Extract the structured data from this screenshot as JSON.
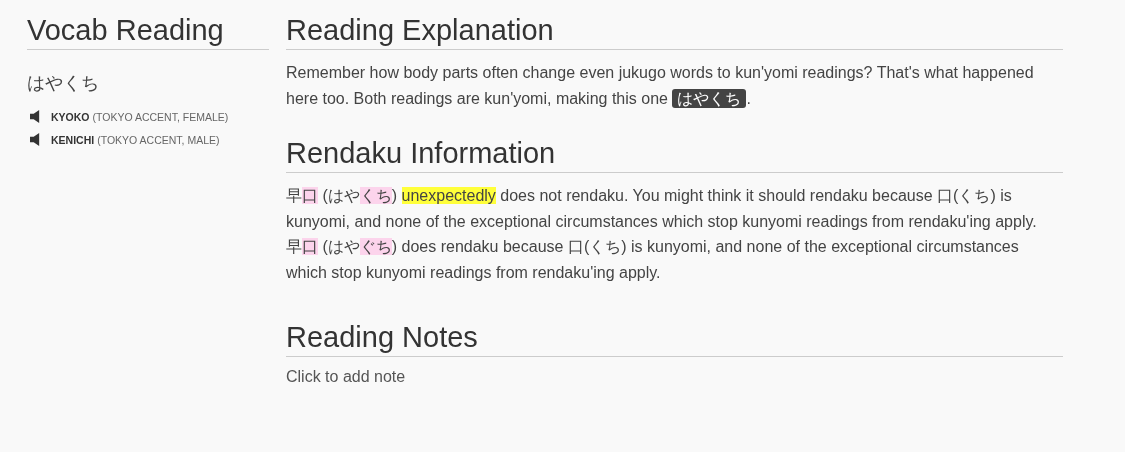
{
  "sidebar": {
    "title": "Vocab Reading",
    "reading": "はやくち",
    "audio": [
      {
        "name": "KYOKO",
        "detail": "(TOKYO ACCENT, FEMALE)"
      },
      {
        "name": "KENICHI",
        "detail": "(TOKYO ACCENT, MALE)"
      }
    ]
  },
  "sections": [
    {
      "title": "Reading Explanation",
      "paragraphs": [
        [
          {
            "text": "Remember how body parts often change even jukugo words to kun'yomi readings? That's what happened here too. Both readings are kun'yomi, making this one ",
            "kind": "plain"
          },
          {
            "text": "はやくち",
            "kind": "chip"
          },
          {
            "text": ".",
            "kind": "plain"
          }
        ]
      ]
    },
    {
      "title": "Rendaku Information",
      "paragraphs": [
        [
          {
            "text": "早",
            "kind": "plain"
          },
          {
            "text": "口",
            "kind": "pink"
          },
          {
            "text": " (はや",
            "kind": "plain"
          },
          {
            "text": "くち",
            "kind": "pink"
          },
          {
            "text": ") ",
            "kind": "plain"
          },
          {
            "text": "unexpectedly",
            "kind": "yellow"
          },
          {
            "text": " does not rendaku. You might think it should rendaku because 口(くち) is kunyomi, and none of the exceptional circumstances which stop kunyomi readings from rendaku'ing apply.",
            "kind": "plain"
          }
        ],
        [
          {
            "text": "早",
            "kind": "plain"
          },
          {
            "text": "口",
            "kind": "pink"
          },
          {
            "text": " (はや",
            "kind": "plain"
          },
          {
            "text": "ぐち",
            "kind": "pink"
          },
          {
            "text": ") does rendaku because 口(くち) is kunyomi, and none of the exceptional circumstances which stop kunyomi readings from rendaku'ing apply.",
            "kind": "plain"
          }
        ]
      ]
    },
    {
      "title": "Reading Notes",
      "note_link": "Click to add note"
    }
  ]
}
